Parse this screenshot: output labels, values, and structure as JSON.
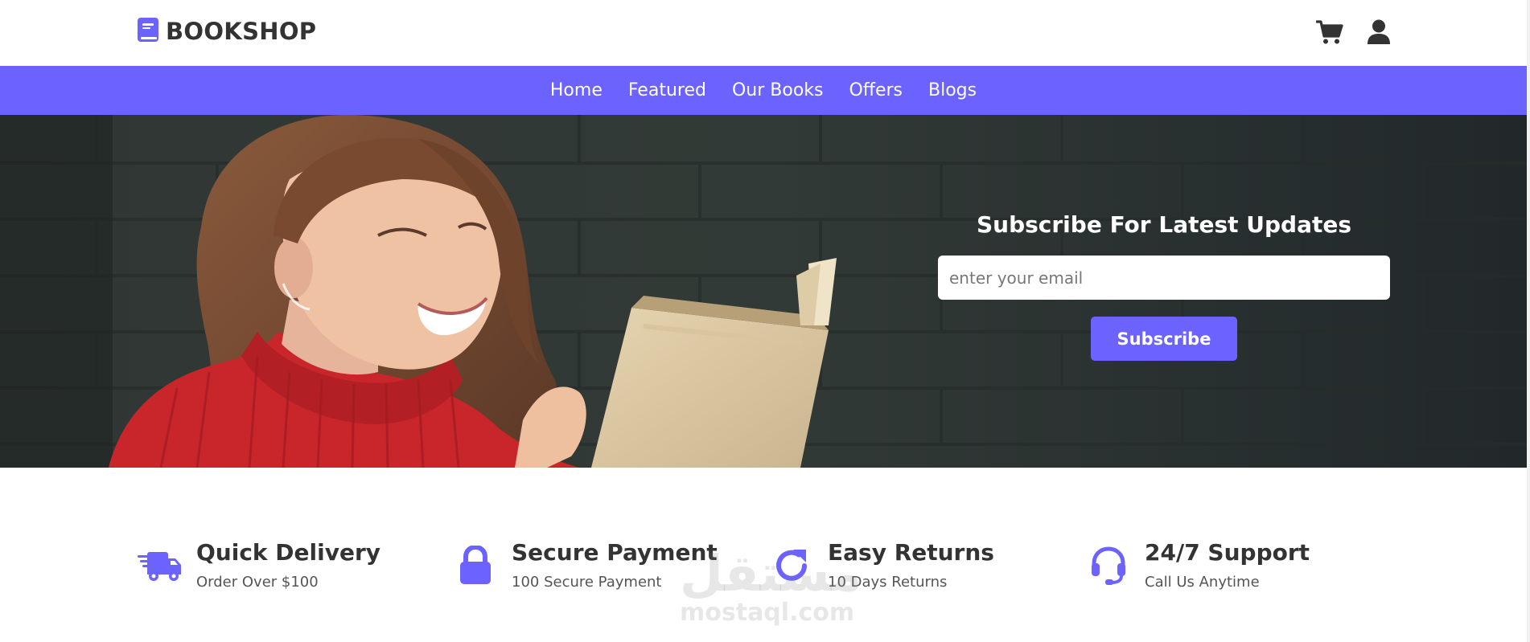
{
  "header": {
    "logo_text": "BOOKSHOP",
    "icons": [
      "book-icon",
      "cart-icon",
      "user-icon"
    ]
  },
  "nav": {
    "items": [
      {
        "label": "Home"
      },
      {
        "label": "Featured"
      },
      {
        "label": "Our Books"
      },
      {
        "label": "Offers"
      },
      {
        "label": "Blogs"
      }
    ]
  },
  "hero": {
    "title": "Subscribe For Latest Updates",
    "email_placeholder": "enter your email",
    "button_label": "Subscribe"
  },
  "features": [
    {
      "icon": "truck-icon",
      "title": "Quick Delivery",
      "subtitle": "Order Over $100"
    },
    {
      "icon": "lock-icon",
      "title": "Secure Payment",
      "subtitle": "100 Secure Payment"
    },
    {
      "icon": "refresh-icon",
      "title": "Easy Returns",
      "subtitle": "10 Days Returns"
    },
    {
      "icon": "headset-icon",
      "title": "24/7 Support",
      "subtitle": "Call Us Anytime"
    }
  ],
  "watermark": {
    "arabic": "مستقل",
    "latin": "mostaql.com"
  },
  "colors": {
    "accent": "#6c63ff",
    "text_dark": "#333333",
    "hero_bg": "#2a302e"
  }
}
